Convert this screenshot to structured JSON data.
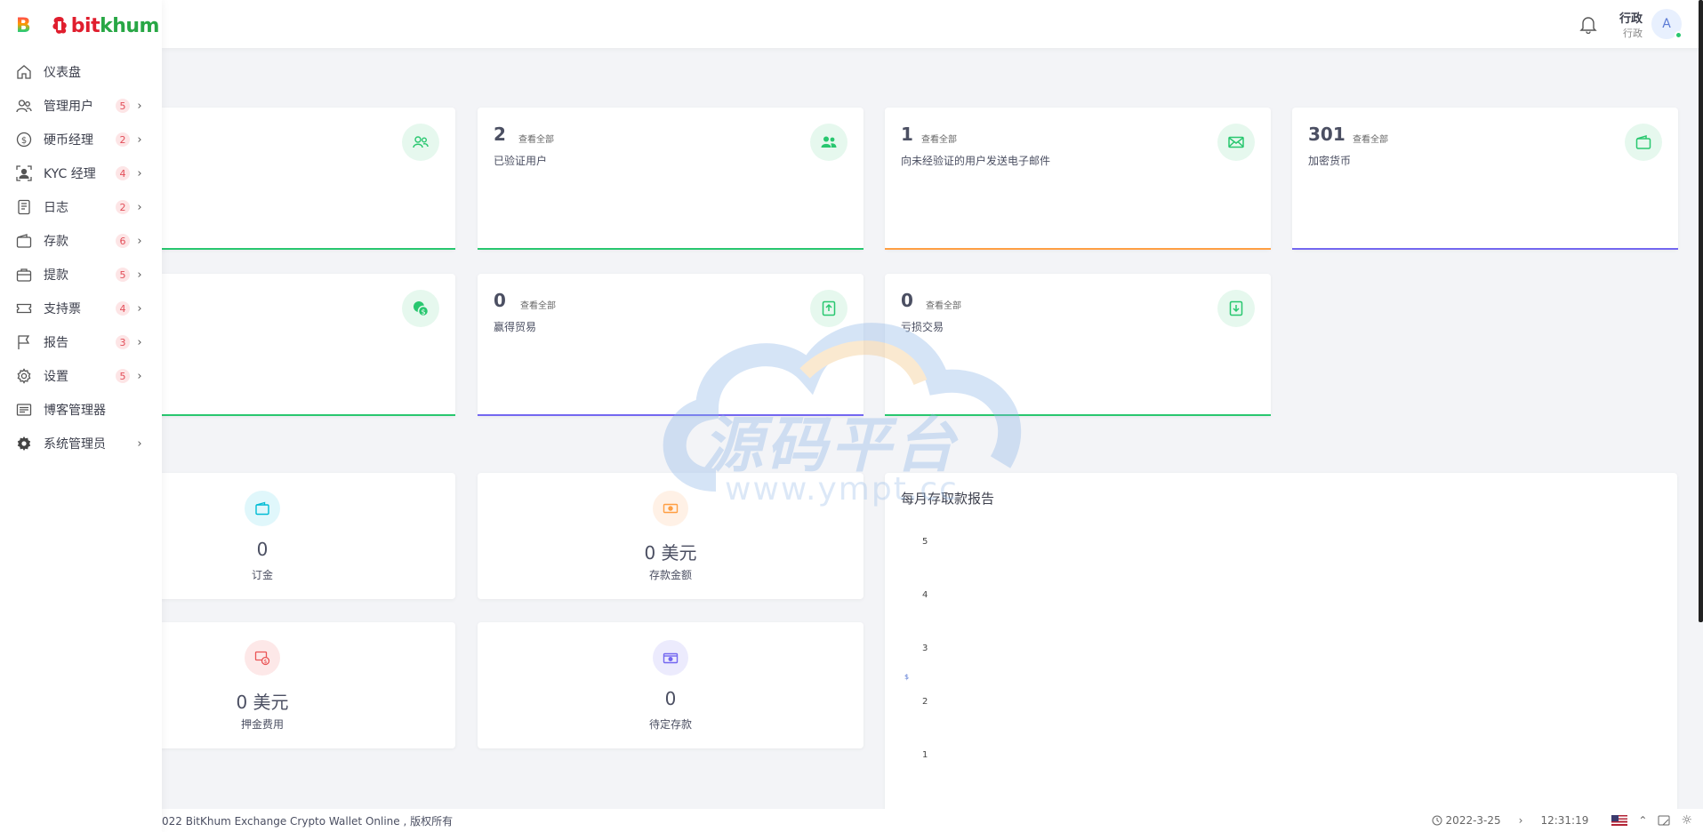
{
  "brand": {
    "mark": "B",
    "name_part1": "bit",
    "name_part2": "khum"
  },
  "sidebar": {
    "items": [
      {
        "label": "仪表盘",
        "badge": "",
        "chev": ""
      },
      {
        "label": "管理用户",
        "badge": "5",
        "chev": "›"
      },
      {
        "label": "硬币经理",
        "badge": "2",
        "chev": "›"
      },
      {
        "label": "KYC 经理",
        "badge": "4",
        "chev": "›"
      },
      {
        "label": "日志",
        "badge": "2",
        "chev": "›"
      },
      {
        "label": "存款",
        "badge": "6",
        "chev": "›"
      },
      {
        "label": "提款",
        "badge": "5",
        "chev": "›"
      },
      {
        "label": "支持票",
        "badge": "4",
        "chev": "›"
      },
      {
        "label": "报告",
        "badge": "3",
        "chev": "›"
      },
      {
        "label": "设置",
        "badge": "5",
        "chev": "›"
      },
      {
        "label": "博客管理器",
        "badge": "",
        "chev": ""
      },
      {
        "label": "系统管理员",
        "badge": "",
        "chev": "›"
      }
    ]
  },
  "topbar": {
    "user_name": "行政",
    "user_role": "行政",
    "avatar_initial": "A"
  },
  "stats": [
    {
      "num": "",
      "viewall": "",
      "desc": "",
      "bar": "#28c76f"
    },
    {
      "num": "2",
      "viewall": "查看全部",
      "desc": "已验证用户",
      "bar": "#28c76f"
    },
    {
      "num": "1",
      "viewall": "查看全部",
      "desc": "向未经验证的用户发送电子邮件",
      "bar": "#ff9f43"
    },
    {
      "num": "301",
      "viewall": "查看全部",
      "desc": "加密货币",
      "bar": "#7367f0"
    },
    {
      "num": "",
      "viewall": "",
      "desc": "",
      "bar": "#28c76f"
    },
    {
      "num": "0",
      "viewall": "查看全部",
      "desc": "赢得贸易",
      "bar": "#7367f0"
    },
    {
      "num": "0",
      "viewall": "查看全部",
      "desc": "亏损交易",
      "bar": "#28c76f"
    }
  ],
  "minis": [
    {
      "value": "0",
      "label": "订金"
    },
    {
      "value": "0 美元",
      "label": "存款金额"
    },
    {
      "value": "0 美元",
      "label": "押金费用"
    },
    {
      "value": "0",
      "label": "待定存款"
    }
  ],
  "chart_data": {
    "type": "line",
    "title": "每月存取款报告",
    "y_ticks": [
      "5",
      "4",
      "3",
      "2",
      "1"
    ],
    "ylim": [
      0,
      5
    ],
    "ylabel": "$",
    "series": []
  },
  "footer": {
    "copyright": "022  BitKhum Exchange Crypto Wallet Online , 版权所有",
    "date": "2022-3-25",
    "time": "12:31:19"
  },
  "watermark": {
    "text": "源码平台",
    "sub": "www.ympt.cc"
  },
  "colors": {
    "green": "#28c76f",
    "orange": "#ff9f43",
    "purple": "#7367f0",
    "red": "#ea5455"
  }
}
